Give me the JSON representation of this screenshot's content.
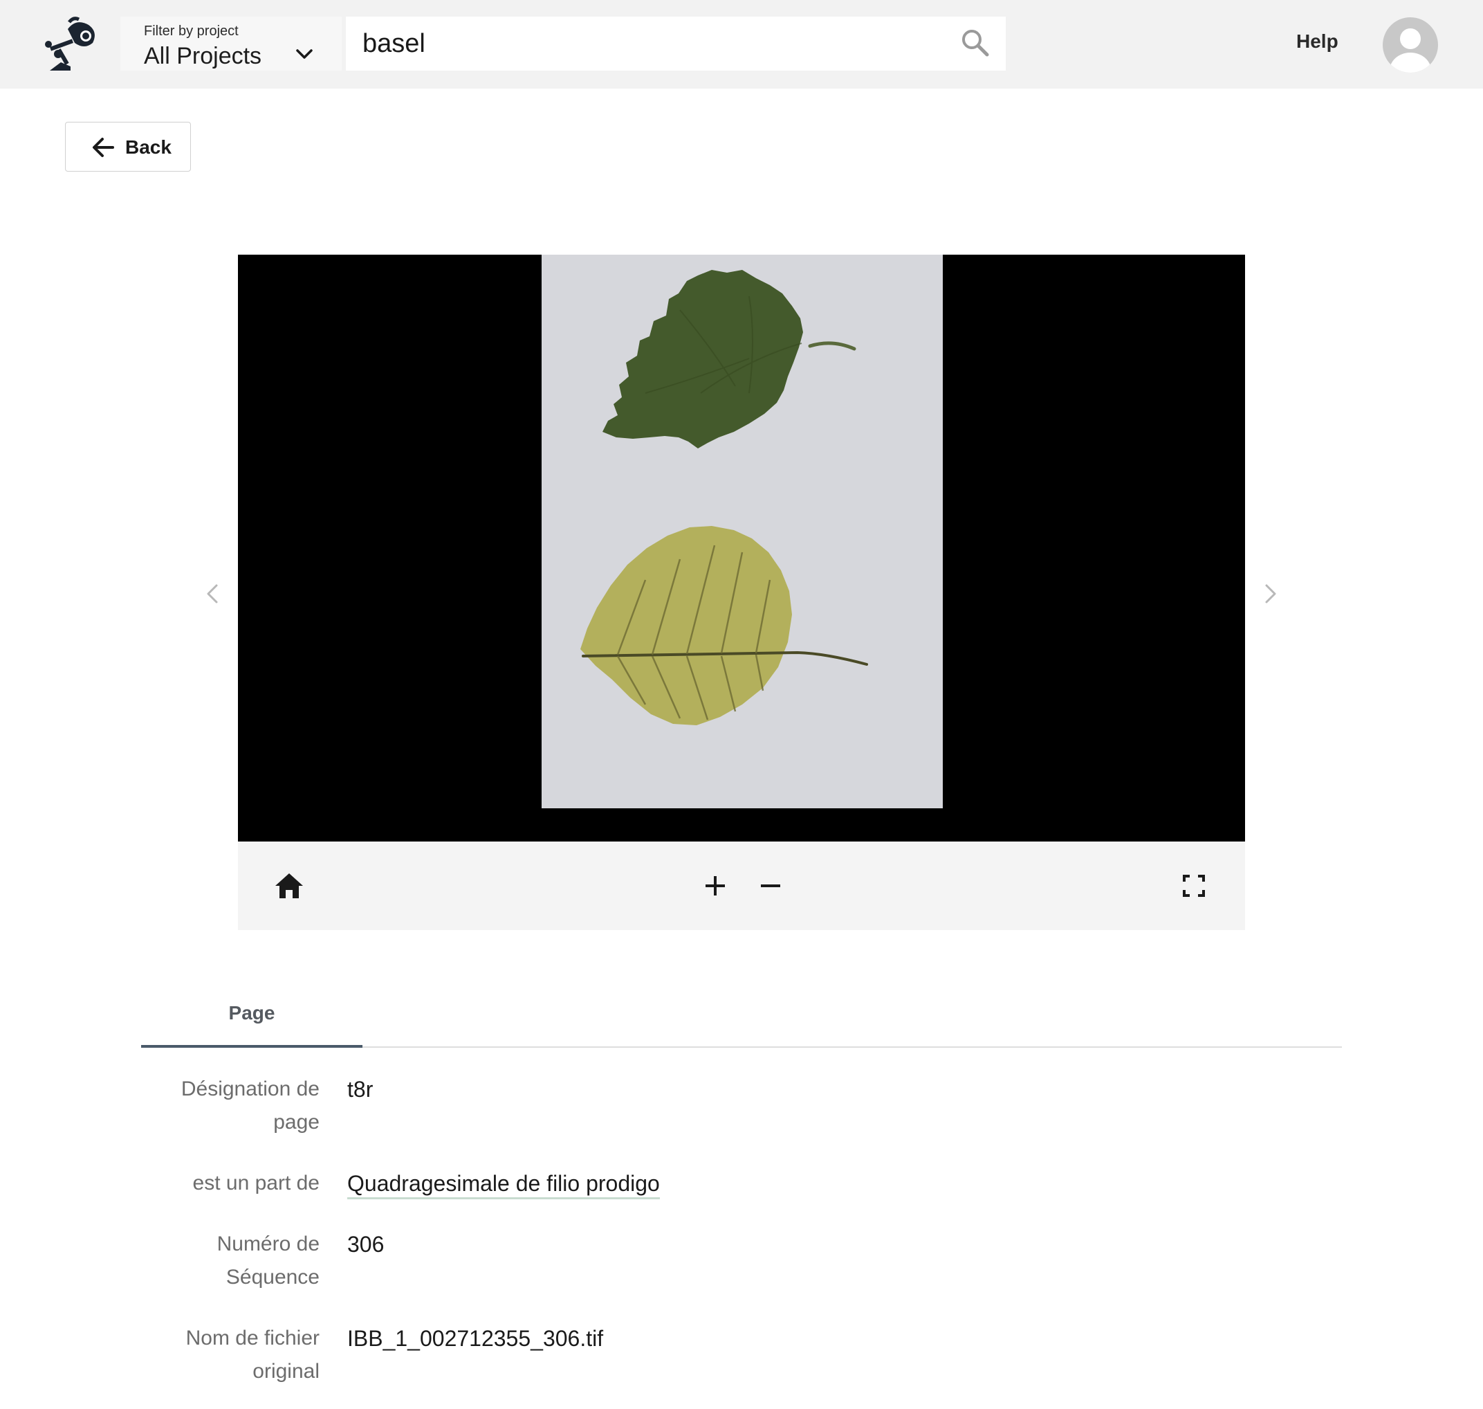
{
  "header": {
    "filter_label": "Filter by project",
    "filter_value": "All Projects",
    "search_value": "basel",
    "help_label": "Help"
  },
  "back_label": "Back",
  "tabs": [
    {
      "label": "Page",
      "active": true
    }
  ],
  "properties": [
    {
      "label_lines": [
        "Désignation de",
        "page"
      ],
      "value": "t8r",
      "is_link": false
    },
    {
      "label_lines": [
        "est un part de"
      ],
      "value": "Quadragesimale de filio prodigo",
      "is_link": true
    },
    {
      "label_lines": [
        "Numéro de",
        "Séquence"
      ],
      "value": "306",
      "is_link": false
    },
    {
      "label_lines": [
        "Nom de fichier",
        "original"
      ],
      "value": "IBB_1_002712355_306.tif",
      "is_link": false
    }
  ],
  "icons": {
    "logo": "lamp-logo-icon",
    "filter": "chevron-down-icon",
    "search": "search-icon",
    "avatar": "user-avatar-icon",
    "back": "arrow-left-icon",
    "prev": "chevron-left-icon",
    "next": "chevron-right-icon",
    "home": "home-icon",
    "zoom_in": "plus-icon",
    "zoom_out": "minus-icon",
    "fullscreen": "fullscreen-icon"
  },
  "colors": {
    "topbar_bg": "#f2f2f2",
    "viewer_bg": "#000000",
    "tab_indicator": "#4a5a6a",
    "link_underline": "#c8dcd0"
  }
}
